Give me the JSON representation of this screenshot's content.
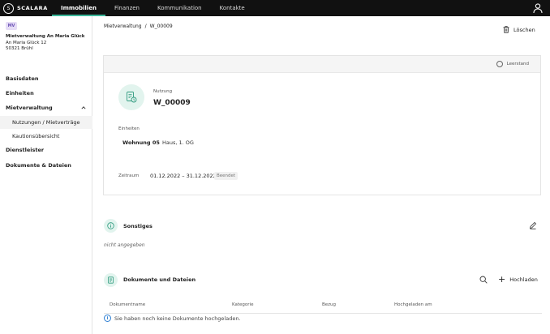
{
  "app": {
    "logo_mark": "S",
    "logo_text": "SCALARA"
  },
  "nav": {
    "tabs": [
      {
        "label": "Immobilien",
        "active": true
      },
      {
        "label": "Finanzen",
        "active": false
      },
      {
        "label": "Kommunikation",
        "active": false
      },
      {
        "label": "Kontakte",
        "active": false
      }
    ]
  },
  "sidebar": {
    "avatar": "MV",
    "company_name": "Mietverwaltung An Maria Glück",
    "address_line1": "An Maria Glück 12",
    "address_line2": "50321 Brühl",
    "items": [
      {
        "label": "Basisdaten"
      },
      {
        "label": "Einheiten"
      },
      {
        "label": "Mietverwaltung"
      },
      {
        "label": "Nutzungen / Mietverträge"
      },
      {
        "label": "Kautionsübersicht"
      },
      {
        "label": "Dienstleister"
      },
      {
        "label": "Dokumente & Dateien"
      }
    ]
  },
  "breadcrumb": {
    "parent": "Mietverwaltung",
    "separator": "/",
    "current": "W_00009"
  },
  "actions": {
    "delete_label": "Löschen",
    "upload_label": "Hochladen"
  },
  "card": {
    "vacancy_label": "Leerstand",
    "usage_label": "Nutzung",
    "usage_value": "W_00009",
    "units_label": "Einheiten",
    "unit_name": "Wohnung 05",
    "unit_desc": "Haus, 1. OG",
    "period_label": "Zeitraum",
    "period_value": "01.12.2022 – 31.12.2022",
    "status_badge": "Beendet"
  },
  "other": {
    "title": "Sonstiges",
    "value": "nicht angegeben"
  },
  "documents": {
    "title": "Dokumente und Dateien",
    "columns": [
      "Dokumentname",
      "Kategorie",
      "Bezug",
      "Hochgeladen am"
    ],
    "empty_message": "Sie haben noch keine Dokumente hochgeladen."
  },
  "colors": {
    "accent": "#3cb89a",
    "accent_light": "#e2f4ee",
    "topbar": "#111111",
    "info": "#2d7fd3"
  }
}
